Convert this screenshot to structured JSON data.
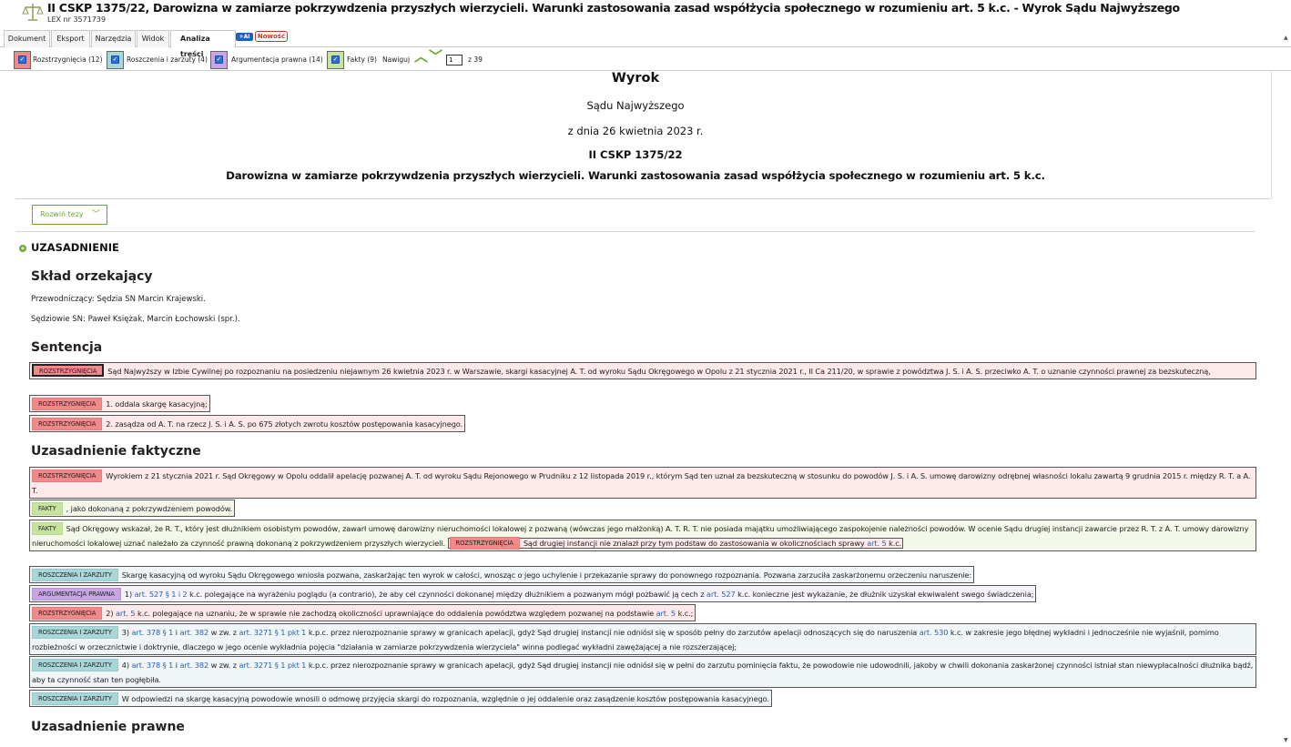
{
  "header": {
    "title": "II CSKP 1375/22, Darowizna w zamiarze pokrzywdzenia przyszłych wierzycieli. Warunki zastosowania zasad współżycia społecznego w rozumieniu art. 5 k.c. - Wyrok Sądu Najwyższego",
    "lex_number": "LEX nr 3571739",
    "logo_icon": "scales-of-justice-icon"
  },
  "tabs": [
    {
      "label": "Dokument"
    },
    {
      "label": "Eksport"
    },
    {
      "label": "Narzędzia"
    },
    {
      "label": "Widok"
    },
    {
      "label": "Analiza treści"
    }
  ],
  "badges": {
    "ai": "+AI",
    "new": "Nowość"
  },
  "filters": [
    {
      "label": "Rozstrzygnięcia (12)",
      "color": "#f1888a",
      "checked": true
    },
    {
      "label": "Roszczenia i zarzuty (4)",
      "color": "#a9d6d8",
      "checked": true
    },
    {
      "label": "Argumentacja prawna (14)",
      "color": "#c8a6e6",
      "checked": true
    },
    {
      "label": "Fakty (9)",
      "color": "#c8e3a0",
      "checked": true
    }
  ],
  "navigation": {
    "label": "Nawiguj",
    "current": "1",
    "total": "z 39"
  },
  "document": {
    "heading": "Wyrok",
    "court": "Sądu Najwyższego",
    "date": "z dnia 26 kwietnia 2023 r.",
    "signature": "II CSKP 1375/22",
    "thesis": "Darowizna w zamiarze pokrzywdzenia przyszłych wierzycieli. Warunki zastosowania zasad współżycia społecznego w rozumieniu art. 5 k.c.",
    "expand_button": "Rozwiń tezy",
    "section_uzasadnienie": "UZASADNIENIE",
    "sklad_heading": "Skład orzekający",
    "przewodniczacy": "Przewodniczący: Sędzia SN Marcin Krajewski.",
    "sedziowie": "Sędziowie SN: Paweł Księżak, Marcin Łochowski (spr.).",
    "sentencja_heading": "Sentencja",
    "faktyczne_heading": "Uzasadnienie faktyczne",
    "prawne_heading": "Uzasadnienie prawne"
  },
  "tags": {
    "roz": "ROZSTRZYGNIĘCIA",
    "fakty": "FAKTY",
    "rosz": "ROSZCZENIA I ZARZUTY",
    "arg": "ARGUMENTACJA PRAWNA"
  },
  "paragraphs": {
    "s1": "Sąd Najwyższy w Izbie Cywilnej po rozpoznaniu na posiedzeniu niejawnym 26 kwietnia 2023 r. w Warszawie, skargi kasacyjnej A. T. od wyroku Sądu Okręgowego w Opolu z 21 stycznia 2021 r., II Ca 211/20, w sprawie z powództwa J. S. i A. S. przeciwko A. T. o uznanie czynności prawnej za bezskuteczną,",
    "s2": "1. oddala skargę kasacyjną;",
    "s3": "2. zasądza od A. T. na rzecz J. S. i A. S. po 675 złotych zwrotu kosztów postępowania kasacyjnego.",
    "f1": "Wyrokiem z 21 stycznia 2021 r. Sąd Okręgowy w Opolu oddalił apelację pozwanej A. T. od wyroku Sądu Rejonowego w Prudniku z 12 listopada 2019 r., którym Sąd ten uznał za bezskuteczną w stosunku do powodów J. S. i A. S. umowę darowizny odrębnej własności lokalu zawartą 9 grudnia 2015 r. między R. T. a A. T.",
    "f2": ", jako dokonaną z pokrzywdzeniem powodów.",
    "f3": "Sąd Okręgowy wskazał, że R. T., który jest dłużnikiem osobistym powodów, zawarł umowę darowizny nieruchomości lokalowej z pozwaną (wówczas jego małżonką) A. T. R. T. nie posiada majątku umożliwiającego zaspokojenie należności powodów. W ocenie Sądu drugiej instancji zawarcie przez R. T. z A. T. umowy darowizny nieruchomości lokalowej uznać należało za czynność prawną dokonaną z pokrzywdzeniem przyszłych wierzycieli.",
    "f3b": "Sąd drugiej instancji nie znalazł przy tym podstaw do zastosowania w okolicznościach sprawy",
    "f3b_link": "art. 5",
    "f3b_end": "k.c.",
    "f4": "Skargę kasacyjną od wyroku Sądu Okręgowego wniosła pozwana, zaskarżając ten wyrok w całości, wnosząc o jego uchylenie i przekazanie sprawy do ponownego rozpoznania. Pozwana zarzuciła zaskarżonemu orzeczeniu naruszenie:",
    "f5_a": "1)",
    "f5_l1": "art. 527 § 1 i 2",
    "f5_b": "k.c. polegające na wyrażeniu poglądu (a contrario), że aby cel czynności dokonanej między dłużnikiem a pozwanym mógł pozbawić ją cech z",
    "f5_l2": "art. 527",
    "f5_c": "k.c. konieczne jest wykazanie, że dłużnik uzyskał ekwiwalent swego świadczenia;",
    "f6_a": "2)",
    "f6_l1": "art. 5",
    "f6_b": "k.c. polegające na uznaniu, że w sprawie nie zachodzą okoliczności uprawniające do oddalenia powództwa względem pozwanej na podstawie",
    "f6_l2": "art. 5",
    "f6_c": "k.c.;",
    "f7_a": "3)",
    "f7_l1": "art. 378 § 1",
    "f7_and": "i",
    "f7_l2": "art. 382",
    "f7_b": "w zw. z",
    "f7_l3": "art. 3271 § 1 pkt 1",
    "f7_c": "k.p.c. przez nierozpoznanie sprawy w granicach apelacji, gdyż Sąd drugiej instancji nie odniósł się w sposób pełny do zarzutów apelacji odnoszących się do naruszenia",
    "f7_l4": "art. 530",
    "f7_d": "k.c. w zakresie jego błędnej wykładni i jednocześnie nie wyjaśnił, pomimo rozbieżności w orzecznictwie i doktrynie, dlaczego w jego ocenie wykładnia pojęcia \"działania w zamiarze pokrzywdzenia wierzyciela\" winna podlegać wykładni zawężającej a nie rozszerzającej;",
    "f8_a": "4)",
    "f8_l1": "art. 378 § 1",
    "f8_and": "i",
    "f8_l2": "art. 382",
    "f8_b": "w zw. z",
    "f8_l3": "art. 3271 § 1 pkt 1",
    "f8_c": "k.p.c. przez nierozpoznanie sprawy w granicach apelacji, gdyż Sąd drugiej instancji nie odniósł się w pełni do zarzutu pominięcia faktu, że powodowie nie udowodnili, jakoby w chwili dokonania zaskarżonej czynności istniał stan niewypłacalności dłużnika bądź, aby ta czynność stan ten pogłębiła.",
    "f9": "W odpowiedzi na skargę kasacyjną powodowie wnosili o odmowę przyjęcia skargi do rozpoznania, względnie o jej oddalenie oraz zasądzenie kosztów postępowania kasacyjnego."
  }
}
